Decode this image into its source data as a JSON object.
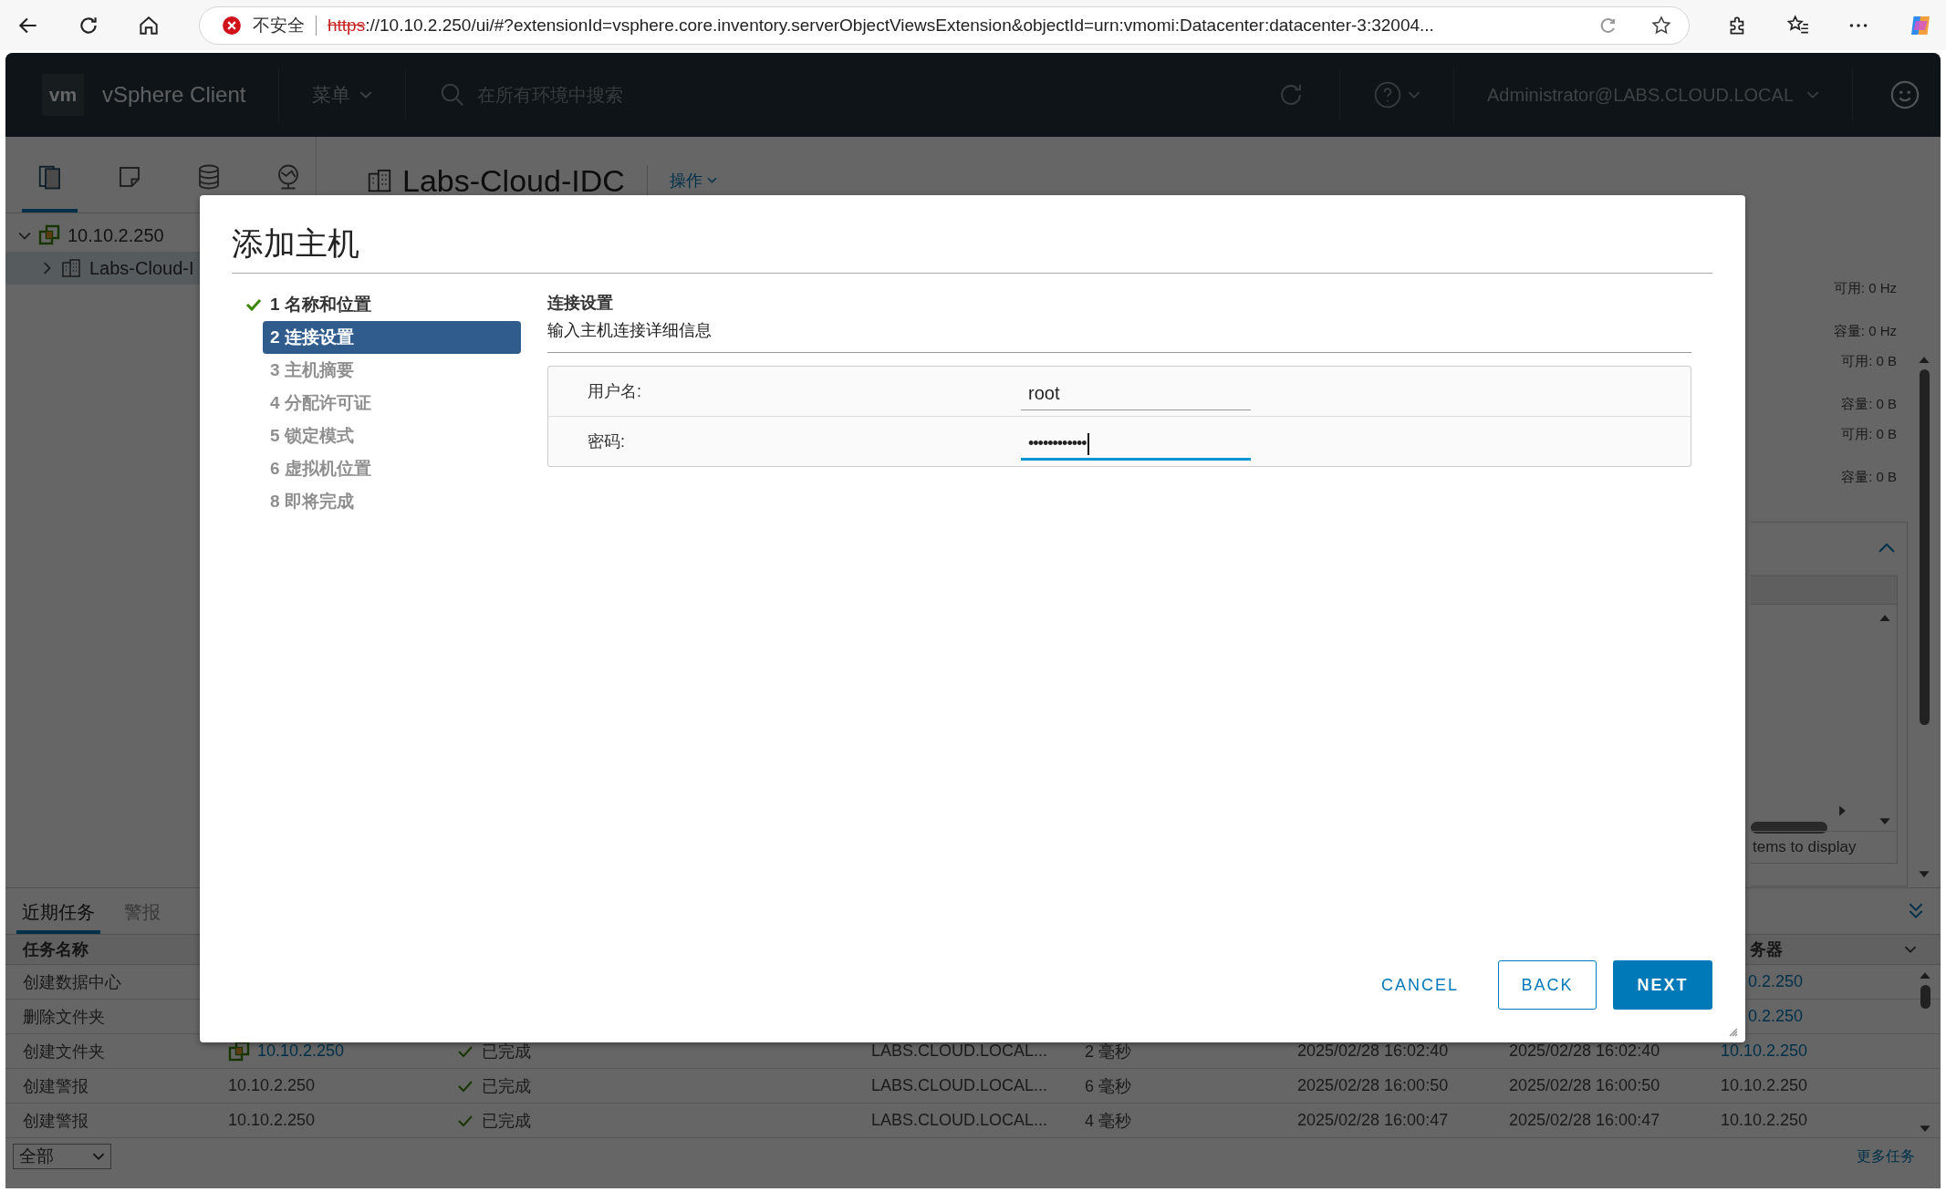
{
  "browser": {
    "security_label": "不安全",
    "url_scheme": "https",
    "url_rest": "://10.10.2.250/ui/#?extensionId=vsphere.core.inventory.serverObjectViewsExtension&objectId=urn:vmomi:Datacenter:datacenter-3:32004..."
  },
  "header": {
    "logo": "vm",
    "product": "vSphere Client",
    "menu": "菜单",
    "search": {
      "placeholder": "在所有环境中搜索"
    },
    "user": "Administrator@LABS.CLOUD.LOCAL"
  },
  "nav_tabs": [
    {
      "kind": "hosts",
      "selected": true
    },
    {
      "kind": "vms",
      "selected": false
    },
    {
      "kind": "storage",
      "selected": false
    },
    {
      "kind": "network",
      "selected": false
    }
  ],
  "tree": [
    {
      "label": "10.10.2.250",
      "expanded": true,
      "selected": false,
      "children": [
        {
          "label": "Labs-Cloud-I",
          "expanded": false,
          "selected": true
        }
      ]
    }
  ],
  "object": {
    "title": "Labs-Cloud-IDC",
    "actions": "操作"
  },
  "summary": [
    "可用: 0 Hz",
    "容量: 0 Hz",
    "可用: 0 B",
    "容量: 0 B",
    "可用: 0 B",
    "容量: 0 B"
  ],
  "side_panel": {
    "footer": "tems to display"
  },
  "tasks": {
    "tabs": [
      {
        "label": "近期任务",
        "selected": true
      },
      {
        "label": "警报",
        "selected": false
      }
    ],
    "columns": [
      {
        "label": "任务名称"
      },
      {
        "label": "务器"
      }
    ],
    "rows": [
      {
        "name": "创建数据中心",
        "server": "0.2.250",
        "server_link": true
      },
      {
        "name": "删除文件夹",
        "server": "0.2.250",
        "server_link": true
      },
      {
        "name": "创建文件夹",
        "target": "10.10.2.250",
        "target_link": true,
        "status": "已完成",
        "initiator": "LABS.CLOUD.LOCAL...",
        "queued": "2 毫秒",
        "start": "2025/02/28 16:02:40",
        "end": "2025/02/28 16:02:40",
        "server": "10.10.2.250",
        "server_link": true
      },
      {
        "name": "创建警报",
        "target": "10.10.2.250",
        "target_link": false,
        "status": "已完成",
        "initiator": "LABS.CLOUD.LOCAL...",
        "queued": "6 毫秒",
        "start": "2025/02/28 16:00:50",
        "end": "2025/02/28 16:00:50",
        "server": "10.10.2.250",
        "server_link": false
      },
      {
        "name": "创建警报",
        "target": "10.10.2.250",
        "target_link": false,
        "status": "已完成",
        "initiator": "LABS.CLOUD.LOCAL...",
        "queued": "4 毫秒",
        "start": "2025/02/28 16:00:47",
        "end": "2025/02/28 16:00:47",
        "server": "10.10.2.250",
        "server_link": false
      }
    ],
    "filter": "全部",
    "more": "更多任务"
  },
  "dialog": {
    "title": "添加主机",
    "steps": [
      {
        "label": "1 名称和位置",
        "completed": true,
        "selected": false
      },
      {
        "label": "2 连接设置",
        "completed": false,
        "selected": true
      },
      {
        "label": "3 主机摘要",
        "completed": false,
        "selected": false
      },
      {
        "label": "4 分配许可证",
        "completed": false,
        "selected": false
      },
      {
        "label": "5 锁定模式",
        "completed": false,
        "selected": false
      },
      {
        "label": "6 虚拟机位置",
        "completed": false,
        "selected": false
      },
      {
        "label": "8 即将完成",
        "completed": false,
        "selected": false
      }
    ],
    "section_title": "连接设置",
    "section_subtitle": "输入主机连接详细信息",
    "fields": [
      {
        "kind": "username",
        "label": "用户名:",
        "value": "root",
        "focused": false
      },
      {
        "kind": "password",
        "label": "密码:",
        "value": "••••••••••••",
        "focused": true
      }
    ],
    "buttons": [
      {
        "label": "CANCEL",
        "kind": "flat"
      },
      {
        "label": "BACK",
        "kind": "outline"
      },
      {
        "label": "NEXT",
        "kind": "primary"
      }
    ]
  }
}
